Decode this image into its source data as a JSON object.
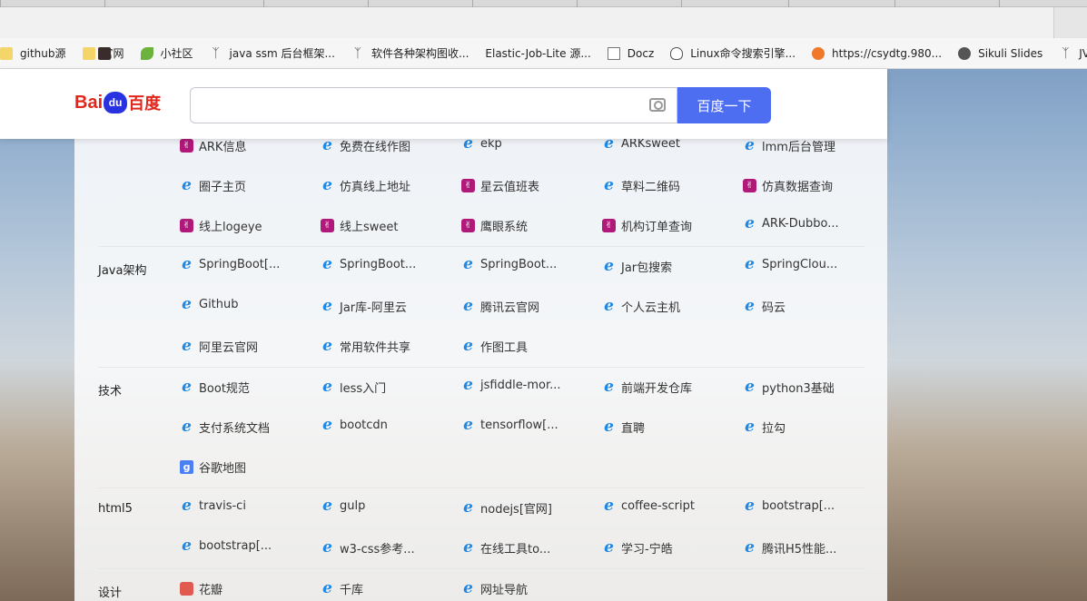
{
  "bookmarks": [
    {
      "label": "github源",
      "icon": "folder-icon"
    },
    {
      "label": "官网",
      "icon": "folder-icon"
    },
    {
      "label": "小社区",
      "icon": "leaf-icon"
    },
    {
      "label": "java ssm 后台框架...",
      "icon": "script-icon"
    },
    {
      "label": "软件各种架构图收...",
      "icon": "script-icon"
    },
    {
      "label": "Elastic-Job-Lite 源...",
      "icon": "cat-icon"
    },
    {
      "label": "Docz",
      "icon": "doc-icon"
    },
    {
      "label": "Linux命令搜索引擎...",
      "icon": "linux-icon"
    },
    {
      "label": "https://csydtg.980...",
      "icon": "fire-icon"
    },
    {
      "label": "Sikuli Slides",
      "icon": "globe-icon"
    },
    {
      "label": "JV",
      "icon": "script-icon"
    }
  ],
  "header": {
    "logo_text": "Bai",
    "logo_du": "du",
    "logo_zh": "百度",
    "search_value": "",
    "search_button": "百度一下"
  },
  "categories": [
    "Java架构",
    "技术",
    "html5",
    "设计"
  ],
  "rows": [
    [
      "ARK信息",
      "免费在线作图",
      "ekp",
      "ARKsweet",
      "lmm后台管理"
    ],
    [
      "圈子主页",
      "仿真线上地址",
      "星云值班表",
      "草料二维码",
      "仿真数据查询"
    ],
    [
      "线上logeye",
      "线上sweet",
      "鹰眼系统",
      "机构订单查询",
      "ARK-Dubbo..."
    ],
    [
      "SpringBoot[...",
      "SpringBoot...",
      "SpringBoot...",
      "Jar包搜索",
      "SpringClou..."
    ],
    [
      "Github",
      "Jar库-阿里云",
      "腾讯云官网",
      "个人云主机",
      "码云"
    ],
    [
      "阿里云官网",
      "常用软件共享",
      "作图工具",
      "",
      ""
    ],
    [
      "Boot规范",
      "less入门",
      "jsfiddle-mor...",
      "前端开发仓库",
      "python3基础"
    ],
    [
      "支付系统文档",
      "bootcdn",
      "tensorflow[...",
      "直聘",
      "拉勾"
    ],
    [
      "谷歌地图",
      "",
      "",
      "",
      ""
    ],
    [
      "travis-ci",
      "gulp",
      "nodejs[官网]",
      "coffee-script",
      "bootstrap[..."
    ],
    [
      "bootstrap[...",
      "w3-css参考...",
      "在线工具to...",
      "学习-宁皓",
      "腾讯H5性能..."
    ],
    [
      "花瓣",
      "千库",
      "网址导航",
      "",
      ""
    ]
  ],
  "icons": [
    [
      "bunny",
      "ie",
      "ie",
      "ie",
      "ie"
    ],
    [
      "ie",
      "ie",
      "bunny",
      "ie",
      "bunny"
    ],
    [
      "bunny",
      "bunny",
      "bunny",
      "bunny",
      "ie"
    ],
    [
      "ie",
      "ie",
      "ie",
      "ie",
      "ie"
    ],
    [
      "ie",
      "ie",
      "ie",
      "ie",
      "ie"
    ],
    [
      "ie",
      "ie",
      "ie",
      "",
      ""
    ],
    [
      "ie",
      "ie",
      "ie",
      "ie",
      "ie"
    ],
    [
      "ie",
      "ie",
      "ie",
      "ie",
      "ie"
    ],
    [
      "google",
      "",
      "",
      "",
      ""
    ],
    [
      "ie",
      "ie",
      "ie",
      "ie",
      "ie"
    ],
    [
      "ie",
      "ie",
      "ie",
      "ie",
      "ie"
    ],
    [
      "huaban",
      "ie",
      "ie",
      "",
      ""
    ]
  ]
}
